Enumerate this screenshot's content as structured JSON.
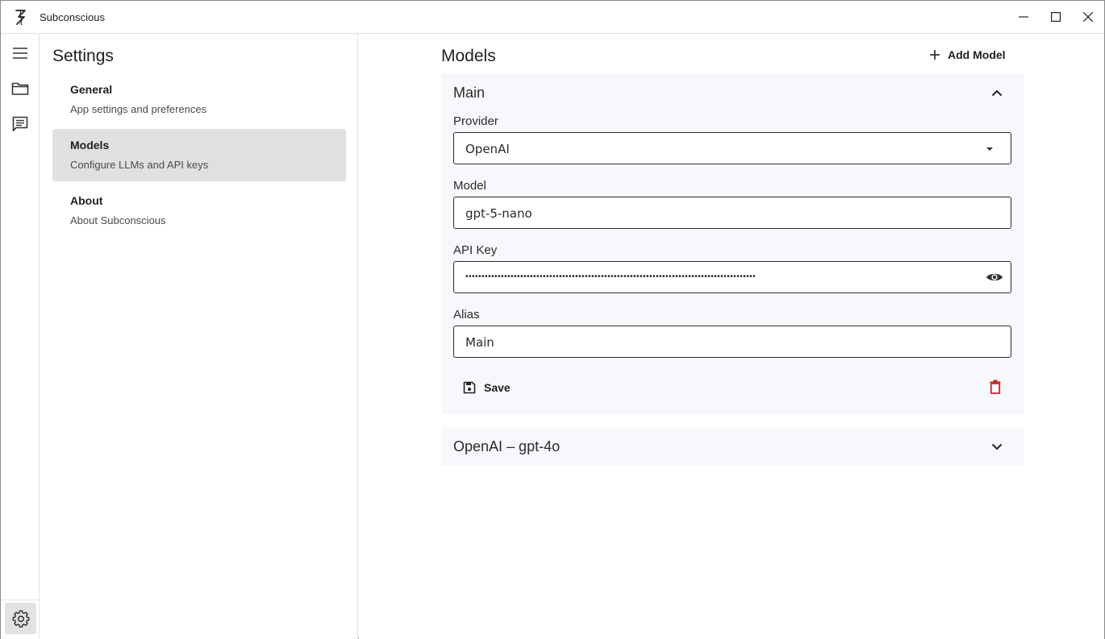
{
  "app": {
    "title": "Subconscious"
  },
  "settings": {
    "title": "Settings",
    "nav": [
      {
        "title": "General",
        "subtitle": "App settings and preferences"
      },
      {
        "title": "Models",
        "subtitle": "Configure LLMs and API keys"
      },
      {
        "title": "About",
        "subtitle": "About Subconscious"
      }
    ],
    "selected": "Models"
  },
  "models": {
    "title": "Models",
    "add_label": "Add Model",
    "cards": [
      {
        "header": "Main",
        "expanded": true,
        "provider_label": "Provider",
        "provider_value": "OpenAI",
        "model_label": "Model",
        "model_value": "gpt-5-nano",
        "apikey_label": "API Key",
        "apikey_mask": "••••••••••••••••••••••••••••••••••••••••••••••••••••••••••••••••••••••••••••••••••••••••••",
        "alias_label": "Alias",
        "alias_value": "Main",
        "save_label": "Save"
      },
      {
        "header": "OpenAI – gpt-4o",
        "expanded": false
      }
    ]
  },
  "icons": {
    "app": "subconscious-logo-icon",
    "rail": [
      "menu-icon",
      "folder-icon",
      "chat-icon",
      "gear-icon"
    ],
    "window": [
      "minimize-icon",
      "maximize-icon",
      "close-icon"
    ]
  },
  "colors": {
    "selected_bg": "#e0e0e0",
    "card_bg": "#f7f8fb",
    "delete_red": "#c62828"
  }
}
